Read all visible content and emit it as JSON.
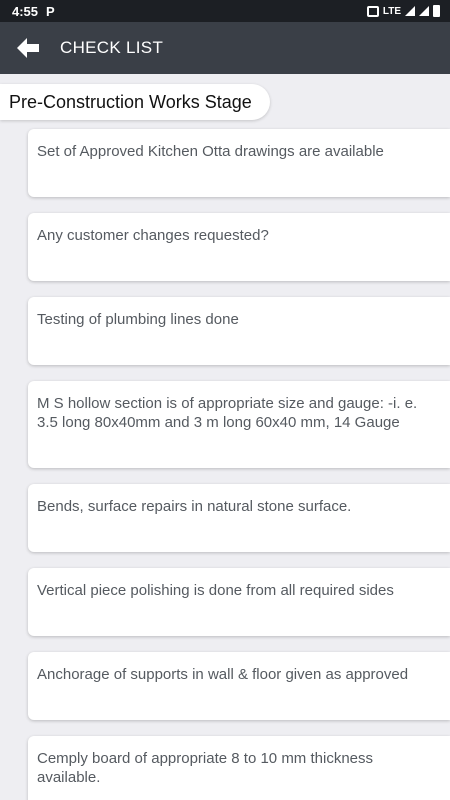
{
  "status_bar": {
    "time": "4:55",
    "notification_icon": "P",
    "network": "LTE"
  },
  "app_bar": {
    "title": "CHECK LIST",
    "back_icon": "arrow-left-icon"
  },
  "stage": {
    "title": "Pre-Construction Works Stage"
  },
  "checklist": [
    {
      "text": "Set of Approved Kitchen Otta drawings are available",
      "height": 68
    },
    {
      "text": "Any customer changes requested?",
      "height": 68
    },
    {
      "text": "Testing of plumbing lines done",
      "height": 68
    },
    {
      "text": "M S hollow section is of appropriate size and gauge: -i. e. 3.5 long 80x40mm and 3 m long 60x40 mm, 14 Gauge",
      "height": 87
    },
    {
      "text": "Bends, surface repairs in natural stone surface.",
      "height": 68
    },
    {
      "text": "Vertical piece polishing is done from all required sides",
      "height": 68
    },
    {
      "text": "Anchorage of supports in wall & floor given as approved",
      "height": 68
    },
    {
      "text": "Cemply board of appropriate 8 to 10 mm thickness available.",
      "height": 87
    }
  ]
}
